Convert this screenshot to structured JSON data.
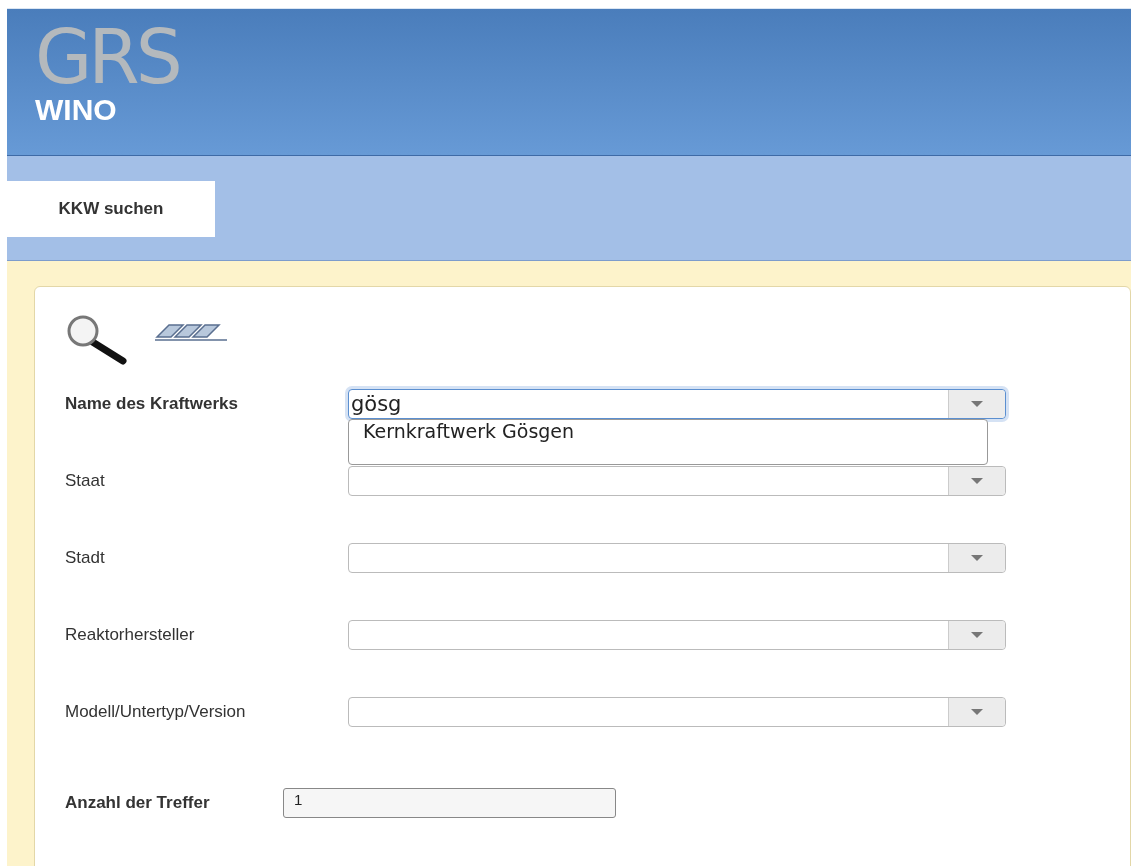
{
  "logo": {
    "mark": "GRS",
    "name": "WINO"
  },
  "tabs": [
    {
      "label": "KKW suchen",
      "selected": true
    }
  ],
  "fields": [
    {
      "label": "Name des Kraftwerks",
      "bold": true,
      "value": "gösg",
      "focused": true,
      "suggestions": [
        "Kernkraftwerk Gösgen"
      ]
    },
    {
      "label": "Staat",
      "bold": false,
      "focused": false
    },
    {
      "label": "Stadt",
      "bold": false,
      "focused": false
    },
    {
      "label": "Reaktorhersteller",
      "bold": false,
      "focused": false
    },
    {
      "label": "Modell/Untertyp/Version",
      "bold": false,
      "focused": false
    }
  ],
  "result": {
    "label": "Anzahl der Treffer",
    "value": "1"
  }
}
